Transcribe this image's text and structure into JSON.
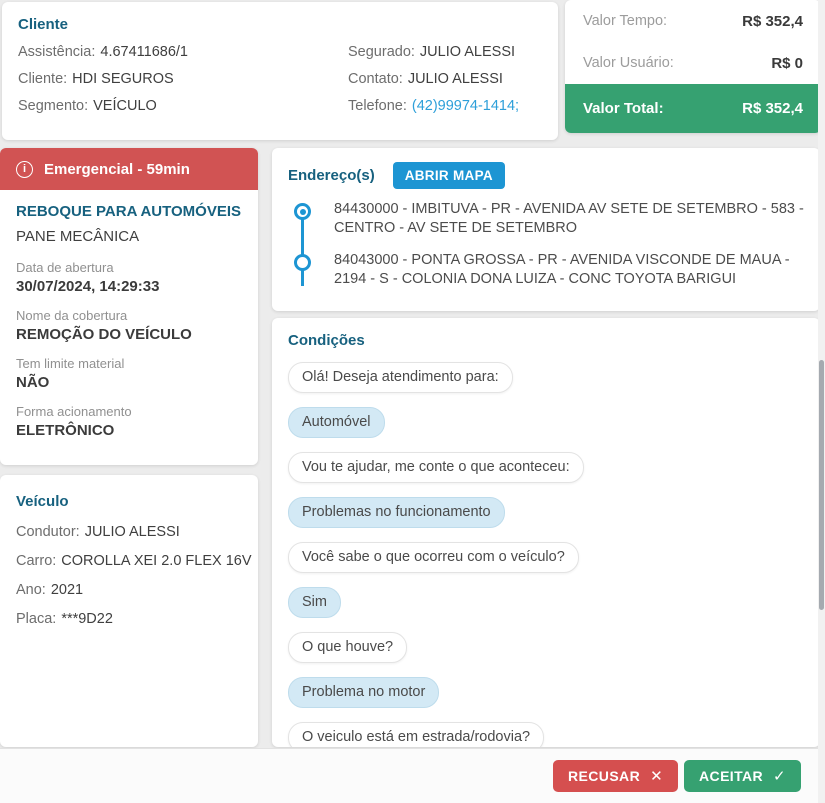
{
  "cliente": {
    "title": "Cliente",
    "fields_left": [
      {
        "label": "Assistência:",
        "value": "4.67411686/1"
      },
      {
        "label": "Cliente:",
        "value": "HDI SEGUROS"
      },
      {
        "label": "Segmento:",
        "value": "VEÍCULO"
      }
    ],
    "fields_right": [
      {
        "label": "Segurado:",
        "value": "JULIO ALESSI"
      },
      {
        "label": "Contato:",
        "value": "JULIO ALESSI"
      },
      {
        "label": "Telefone:",
        "value": "(42)99974-1414;"
      }
    ]
  },
  "valores": {
    "rows": [
      {
        "label": "Valor Tempo:",
        "value": "R$ 352,4"
      },
      {
        "label": "Valor Usuário:",
        "value": "R$ 0"
      }
    ],
    "total": {
      "label": "Valor Total:",
      "value": "R$ 352,4"
    }
  },
  "servico": {
    "banner": "Emergencial - 59min",
    "titulo": "REBOQUE PARA AUTOMÓVEIS",
    "subtitulo": "PANE MECÂNICA",
    "campos": [
      {
        "label": "Data de abertura",
        "value": "30/07/2024, 14:29:33"
      },
      {
        "label": "Nome da cobertura",
        "value": "REMOÇÃO DO VEÍCULO"
      },
      {
        "label": "Tem limite material",
        "value": "NÃO"
      },
      {
        "label": "Forma acionamento",
        "value": "ELETRÔNICO"
      }
    ]
  },
  "veiculo": {
    "title": "Veículo",
    "fields": [
      {
        "label": "Condutor:",
        "value": "JULIO ALESSI"
      },
      {
        "label": "Carro:",
        "value": "COROLLA XEI 2.0 FLEX 16V"
      },
      {
        "label": "Ano:",
        "value": "2021"
      },
      {
        "label": "Placa:",
        "value": "***9D22"
      }
    ]
  },
  "enderecos": {
    "title": "Endereço(s)",
    "map_button": "ABRIR MAPA",
    "items": [
      {
        "text": "84430000 - IMBITUVA - PR - AVENIDA AV SETE DE SETEMBRO - 583 - CENTRO - AV SETE DE SETEMBRO"
      },
      {
        "text": "84043000 - PONTA GROSSA - PR - AVENIDA VISCONDE DE MAUA - 2194 - S - COLONIA DONA LUIZA - CONC TOYOTA BARIGUI"
      }
    ]
  },
  "condicoes": {
    "title": "Condições",
    "messages": [
      {
        "type": "question",
        "text": "Olá! Deseja atendimento para:"
      },
      {
        "type": "answer",
        "text": "Automóvel"
      },
      {
        "type": "question",
        "text": "Vou te ajudar, me conte o que aconteceu:"
      },
      {
        "type": "answer",
        "text": "Problemas no funcionamento"
      },
      {
        "type": "question",
        "text": "Você sabe o que ocorreu com o veículo?"
      },
      {
        "type": "answer",
        "text": "Sim"
      },
      {
        "type": "question",
        "text": "O que houve?"
      },
      {
        "type": "answer",
        "text": "Problema no motor"
      },
      {
        "type": "question",
        "text": "O veiculo está em estrada/rodovia?"
      }
    ]
  },
  "footer": {
    "recusar": "RECUSAR",
    "aceitar": "ACEITAR"
  },
  "icons": {
    "info": "i",
    "close": "✕",
    "check": "✓"
  },
  "accent_colors": {
    "heading_blue": "#17617f",
    "primary_blue": "#1d95d3",
    "link_blue": "#2d9fd9",
    "danger_red": "#d15353",
    "success_green": "#36a171"
  }
}
